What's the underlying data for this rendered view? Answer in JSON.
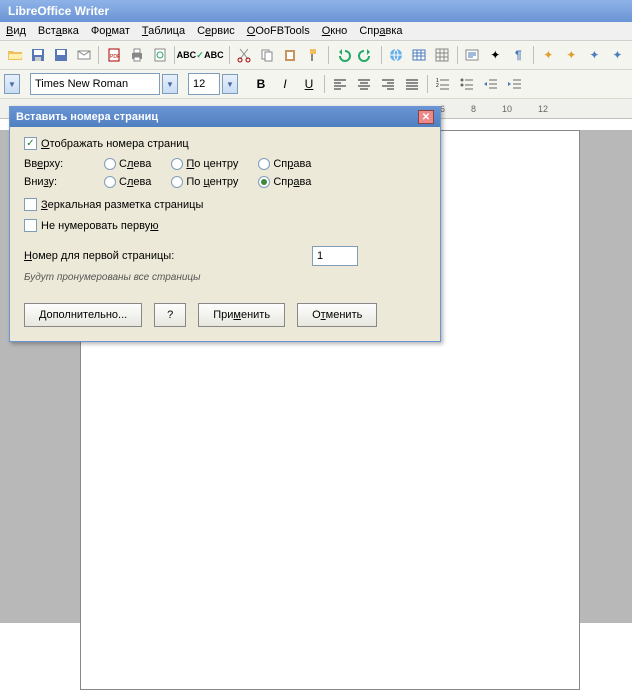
{
  "app": {
    "title": "LibreOffice Writer"
  },
  "menu": {
    "view": "Вид",
    "insert": "Вставка",
    "format": "Формат",
    "table": "Таблица",
    "tools": "Сервис",
    "ooofb": "OOoFBTools",
    "window": "Окно",
    "help": "Справка"
  },
  "toolbar2": {
    "font": "Times New Roman",
    "size": "12"
  },
  "ruler": {
    "t6": "6",
    "t8": "8",
    "t10": "10",
    "t12": "12"
  },
  "dialog": {
    "title": "Вставить номера страниц",
    "show_numbers": "Отображать номера страниц",
    "top_label": "Вверху:",
    "bottom_label": "Внизу:",
    "left": "Слева",
    "center": "По центру",
    "right": "Справа",
    "mirror": "Зеркальная разметка страницы",
    "no_first": "Не нумеровать первую",
    "first_num_label": "Номер для первой страницы:",
    "first_num_value": "1",
    "hint": "Будут пронумерованы все страницы",
    "btn_more": "Дополнительно...",
    "btn_q": "?",
    "btn_apply": "Применить",
    "btn_cancel": "Отменить"
  }
}
